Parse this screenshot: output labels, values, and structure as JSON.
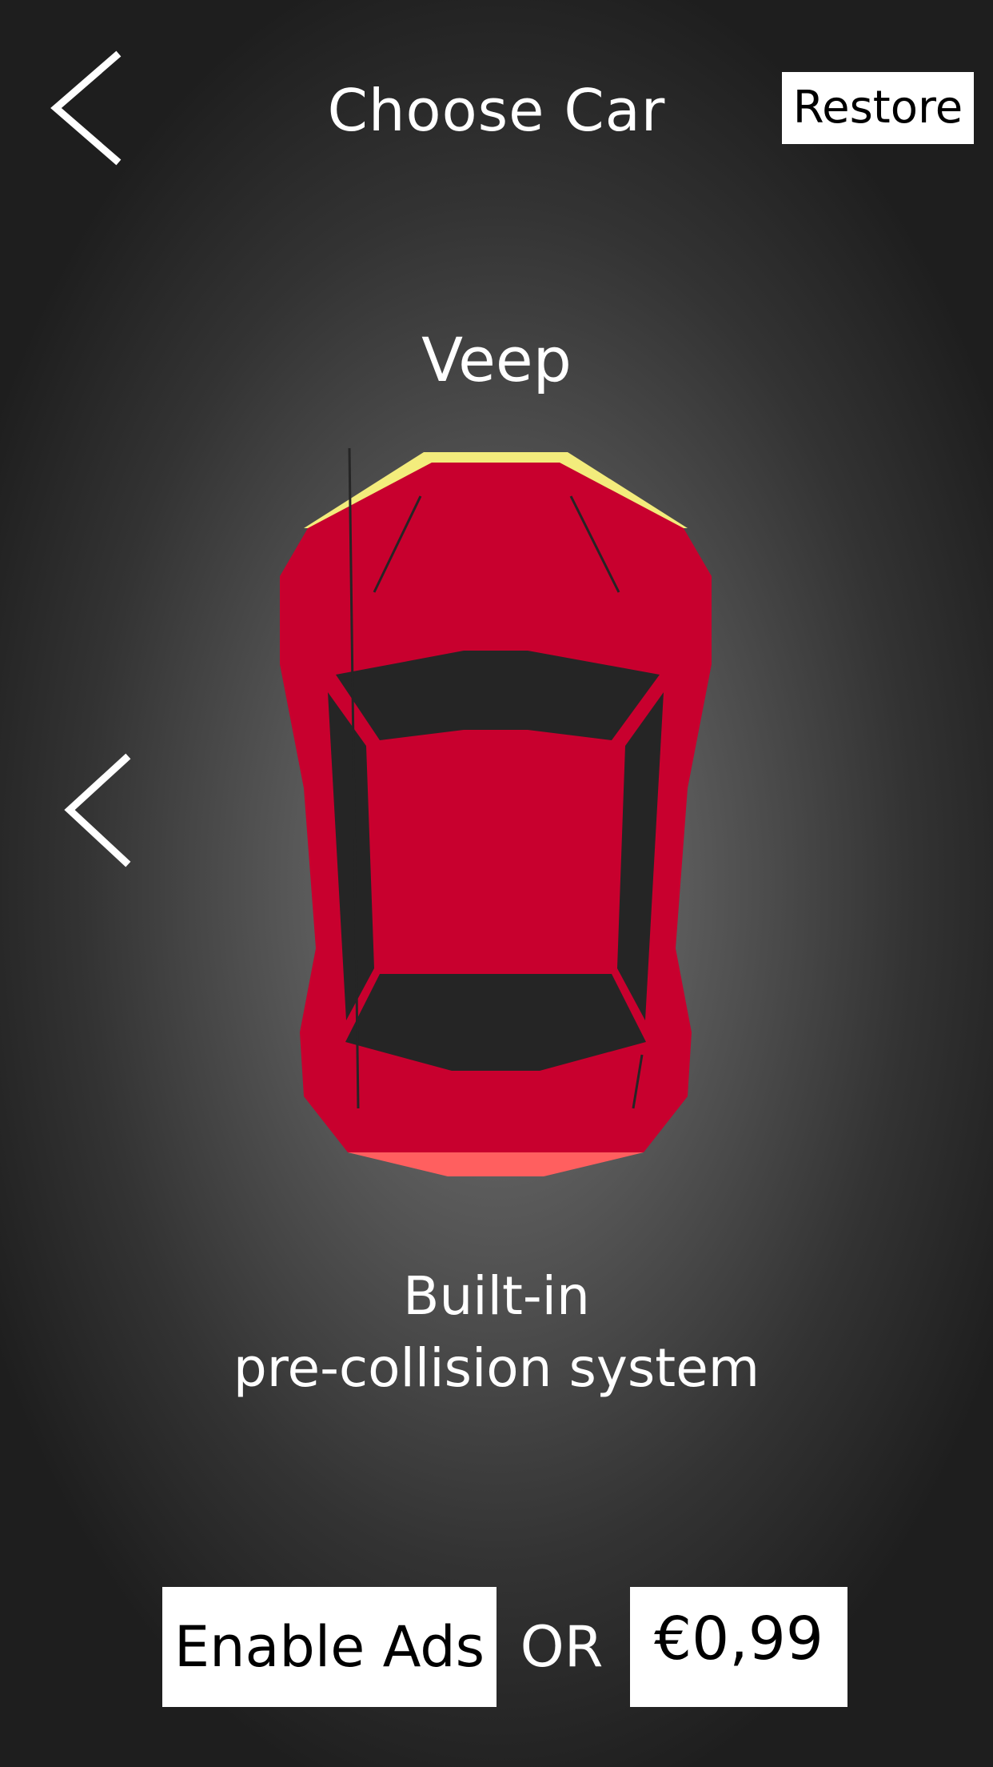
{
  "header": {
    "title": "Choose Car",
    "restore_label": "Restore",
    "back_icon": "chevron-left-icon"
  },
  "car": {
    "name": "Veep",
    "feature_line1": "Built-in",
    "feature_line2": "pre-collision system",
    "prev_icon": "chevron-left-icon",
    "colors": {
      "body": "#c8002e",
      "windows": "#252525",
      "headlights": "#f3ec7c",
      "taillights": "#ff5f5f"
    }
  },
  "purchase": {
    "enable_ads_label": "Enable Ads",
    "or_label": "OR",
    "price_label": "€0,99"
  }
}
